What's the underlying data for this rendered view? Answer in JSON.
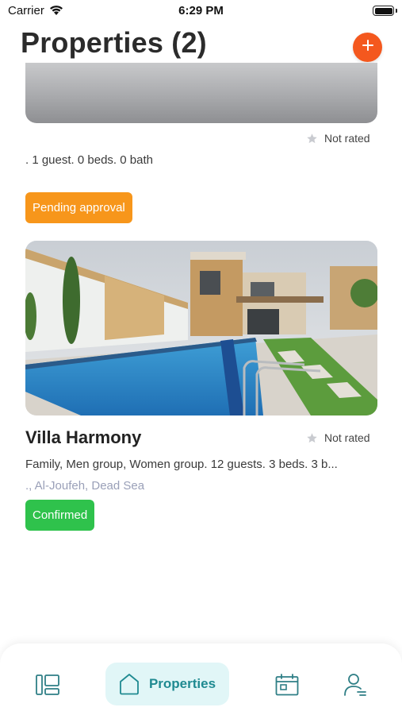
{
  "status_bar": {
    "carrier": "Carrier",
    "time": "6:29 PM"
  },
  "header": {
    "title": "Properties (2)",
    "add_icon": "plus-icon",
    "accent_color": "#f4581e"
  },
  "properties": [
    {
      "rating": "Not rated",
      "details": ". 1 guest. 0 beds. 0 bath",
      "status": "Pending approval",
      "status_color": "#f7961b"
    },
    {
      "title": "Villa Harmony",
      "rating": "Not rated",
      "details": "Family, Men group, Women group. 12 guests. 3 beds. 3 b...",
      "location": "., Al-Joufeh, Dead Sea",
      "status": "Confirmed",
      "status_color": "#2fc24c"
    }
  ],
  "bottom_nav": {
    "items": [
      {
        "icon": "dashboard-icon"
      },
      {
        "icon": "home-icon",
        "label": "Properties",
        "active": true
      },
      {
        "icon": "calendar-icon"
      },
      {
        "icon": "profile-icon"
      }
    ],
    "active_color": "#1f8a91"
  }
}
